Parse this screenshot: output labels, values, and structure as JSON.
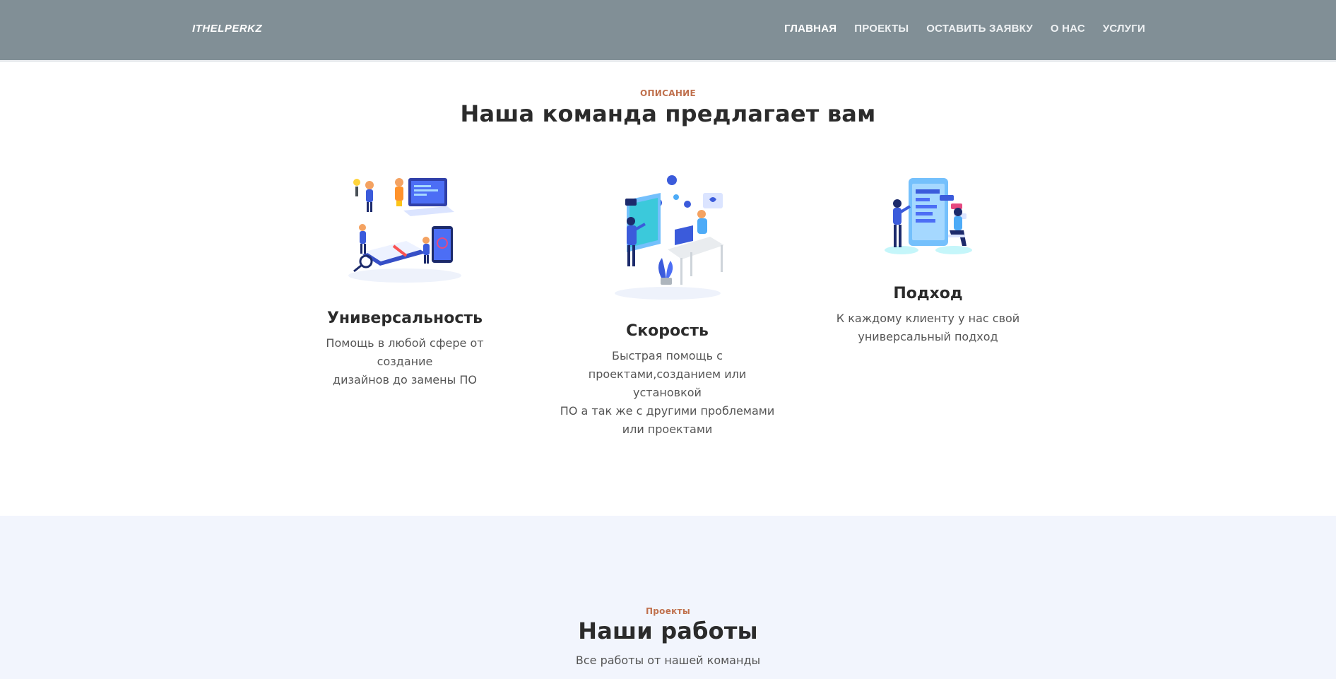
{
  "header": {
    "logo": "ITHELPERKZ",
    "nav": [
      {
        "label": "ГЛАВНАЯ"
      },
      {
        "label": "ПРОЕКТЫ"
      },
      {
        "label": "ОСТАВИТЬ ЗАЯВКУ"
      },
      {
        "label": "О НАС"
      },
      {
        "label": "УСЛУГИ"
      }
    ]
  },
  "about": {
    "eyebrow": "ОПИСАНИЕ",
    "title": "Наша команда предлагает вам",
    "features": [
      {
        "title": "Универсальность",
        "desc1": "Помощь в любой сфере от создание",
        "desc2": "дизайнов до замены ПО",
        "icon": "illustration-universality"
      },
      {
        "title": "Скорость",
        "desc1": "Быстрая помощь с",
        "desc2": "проектами,созданием или установкой",
        "desc3": "ПО а так же с другими проблемами",
        "desc4": "или проектами",
        "icon": "illustration-speed"
      },
      {
        "title": "Подход",
        "desc1": "К каждому клиенту у нас свой",
        "desc2": "универсальный подход",
        "icon": "illustration-approach"
      }
    ]
  },
  "projects": {
    "eyebrow": "Проекты",
    "title": "Наши работы",
    "subtitle": "Все работы от нашей команды"
  },
  "colors": {
    "header_bg": "#818f96",
    "accent": "#c0714e",
    "illustration_primary": "#3b5bdb",
    "illustration_secondary": "#4dabf7",
    "section_bg": "#f2f5fd"
  }
}
